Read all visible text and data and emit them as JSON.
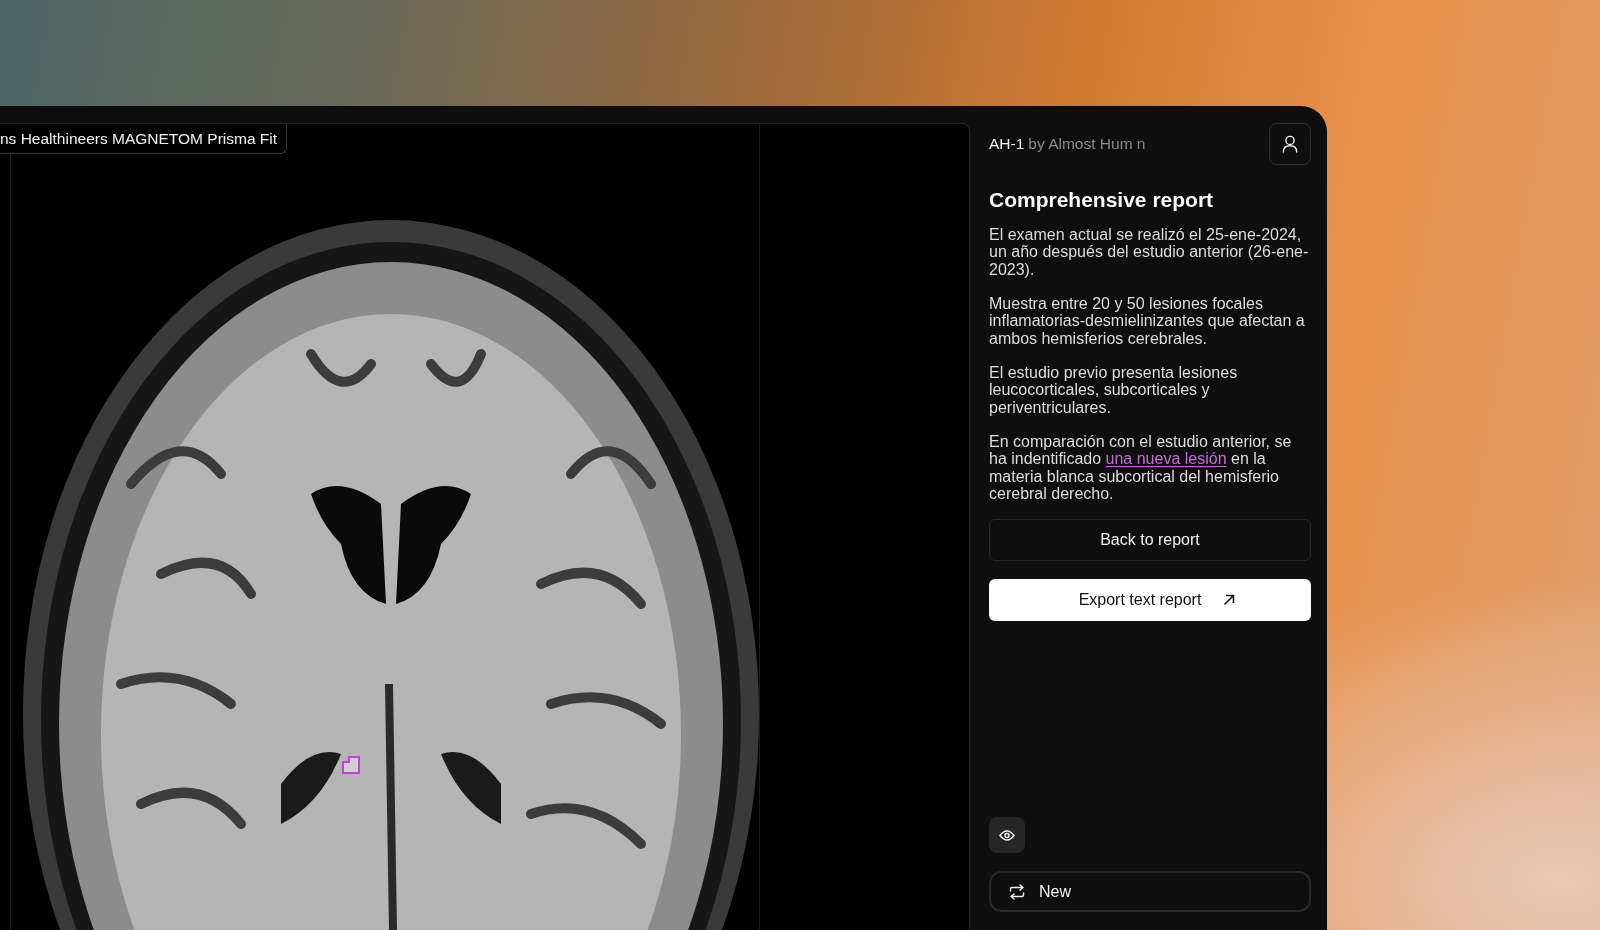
{
  "viewer": {
    "scanner_label": "ns Healthineers MAGNETOM Prisma Fit"
  },
  "panel": {
    "model": "AH-1",
    "author": "by Almost Hum n",
    "title": "Comprehensive report",
    "paragraphs": [
      [
        {
          "kind": "text",
          "text": "El examen actual se realizó el 25-ene-2024, un año después del estudio anterior (26-ene-2023)."
        }
      ],
      [
        {
          "kind": "text",
          "text": "Muestra entre 20 y 50 lesiones focales inflamatorias-desmielinizantes que afectan a ambos hemisferios cerebrales."
        }
      ],
      [
        {
          "kind": "text",
          "text": "El estudio previo presenta lesiones leucocorticales, subcorticales y periventriculares."
        }
      ],
      [
        {
          "kind": "text",
          "text": "En comparación con el estudio anterior, se ha indentificado"
        },
        {
          "kind": "link",
          "text": "una nueva lesión"
        },
        {
          "kind": "text",
          "text": "en la materia blanca subcortical del hemisferio cerebral derecho."
        }
      ]
    ],
    "actions": [
      {
        "label": "Back to report",
        "kind": "outline"
      },
      {
        "label": "Export text report",
        "kind": "primary"
      }
    ],
    "new_button": {
      "label": "New"
    }
  }
}
